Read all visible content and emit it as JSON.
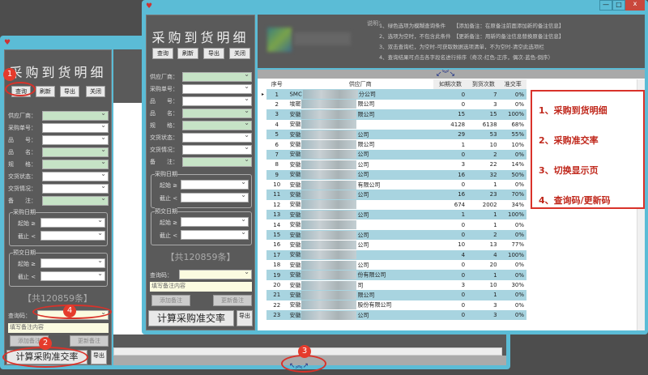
{
  "app": {
    "title": "采购到货明细",
    "buttons": [
      "查询",
      "刷新",
      "导出",
      "关闭"
    ]
  },
  "filters": {
    "labels": [
      "供应厂商：",
      "采购单号：",
      "品　　号：",
      "品　　名：",
      "规　　格：",
      "交货状态：",
      "交货情况：",
      "备　　注："
    ],
    "purchase_date": {
      "title": "采购日期",
      "start": "起始 ≥",
      "end": "截止 <"
    },
    "delivery_date": {
      "title": "预交日期",
      "start": "起始 ≥",
      "end": "截止 <"
    }
  },
  "record_count": "【共120859条】",
  "query_code_label": "查询码：",
  "remark_placeholder": "填写备注内容",
  "add_remark": "添加备注",
  "update_remark": "更新备注",
  "calc_button": "计算采购准交率",
  "export_button": "导出",
  "notes": {
    "title": "说明：",
    "lines": [
      "1、绿色选项为模糊查询条件　　【添加备注：在原备注前面添加新的备注信息】",
      "2、选项为空时，不包含此条件　【更新备注：用新的备注信息替换原备注信息】",
      "3、双击查询栏，为空时-可获取数据选项清单，不为空时-清空此选项栏",
      "4、查询结果可点击各字段名进行排序（奇次-红色-正序，偶次-蓝色-倒序）"
    ]
  },
  "table": {
    "headers": [
      "序号",
      "供应厂商",
      "如期次数",
      "到货次数",
      "准交率"
    ],
    "rows": [
      [
        "1",
        "SMC",
        "分公司",
        "0",
        "7",
        "0%"
      ],
      [
        "2",
        "埃密",
        "限公司",
        "0",
        "3",
        "0%"
      ],
      [
        "3",
        "安徽",
        "限公司",
        "15",
        "15",
        "100%"
      ],
      [
        "4",
        "安徽",
        "",
        "4128",
        "6138",
        "68%"
      ],
      [
        "5",
        "安徽",
        "公司",
        "29",
        "53",
        "55%"
      ],
      [
        "6",
        "安徽",
        "限公司",
        "1",
        "10",
        "10%"
      ],
      [
        "7",
        "安徽",
        "公司",
        "0",
        "2",
        "0%"
      ],
      [
        "8",
        "安徽",
        "公司",
        "3",
        "22",
        "14%"
      ],
      [
        "9",
        "安徽",
        "公司",
        "16",
        "32",
        "50%"
      ],
      [
        "10",
        "安徽",
        "有限公司",
        "0",
        "1",
        "0%"
      ],
      [
        "11",
        "安徽",
        "公司",
        "16",
        "23",
        "70%"
      ],
      [
        "12",
        "安徽",
        "",
        "674",
        "2002",
        "34%"
      ],
      [
        "13",
        "安徽",
        "公司",
        "1",
        "1",
        "100%"
      ],
      [
        "14",
        "安徽",
        "",
        "0",
        "1",
        "0%"
      ],
      [
        "15",
        "安徽",
        "公司",
        "0",
        "2",
        "0%"
      ],
      [
        "16",
        "安徽",
        "公司",
        "10",
        "13",
        "77%"
      ],
      [
        "17",
        "安徽",
        "",
        "4",
        "4",
        "100%"
      ],
      [
        "18",
        "安徽",
        "公司",
        "0",
        "20",
        "0%"
      ],
      [
        "19",
        "安徽",
        "份有限公司",
        "0",
        "1",
        "0%"
      ],
      [
        "20",
        "安徽",
        "司",
        "3",
        "10",
        "30%"
      ],
      [
        "21",
        "安徽",
        "限公司",
        "0",
        "1",
        "0%"
      ],
      [
        "22",
        "安徽",
        "股份有限公司",
        "0",
        "3",
        "0%"
      ],
      [
        "23",
        "安徽",
        "公司",
        "0",
        "3",
        "0%"
      ]
    ]
  },
  "annotations": [
    "1、采购到货明细",
    "2、采购准交率",
    "3、切换显示页",
    "4、查询码/更新码"
  ],
  "badges": [
    "1",
    "2",
    "3",
    "4"
  ],
  "window_controls": [
    "—",
    "□",
    "x"
  ],
  "colors": {
    "accent_red": "#d9322a",
    "row_blue": "#a8d4e0",
    "field_green": "#c6e3c6",
    "frame": "#5bbcd6"
  }
}
